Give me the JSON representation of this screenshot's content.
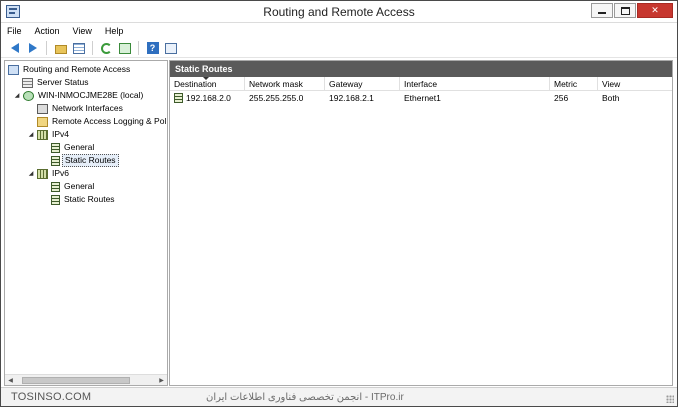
{
  "window": {
    "title": "Routing and Remote Access"
  },
  "menu": [
    "File",
    "Action",
    "View",
    "Help"
  ],
  "toolbar": {
    "icons": [
      "back-arrow-icon",
      "forward-arrow-icon",
      "up-folder-icon",
      "show-hide-tree-icon",
      "refresh-icon",
      "export-list-icon",
      "help-icon",
      "properties-icon"
    ]
  },
  "tree": {
    "items": [
      {
        "label": "Routing and Remote Access",
        "icon": "rra-icon",
        "level": 0,
        "expander": ""
      },
      {
        "label": "Server Status",
        "icon": "server-status-icon",
        "level": 1,
        "expander": ""
      },
      {
        "label": "WIN-INMOCJME28E (local)",
        "icon": "local-server-icon",
        "level": 1,
        "expander": "◢"
      },
      {
        "label": "Network Interfaces",
        "icon": "network-interfaces-icon",
        "level": 2,
        "expander": ""
      },
      {
        "label": "Remote Access Logging & Pol",
        "icon": "logging-icon",
        "level": 2,
        "expander": ""
      },
      {
        "label": "IPv4",
        "icon": "ipv4-icon",
        "level": 2,
        "expander": "◢"
      },
      {
        "label": "General",
        "icon": "general-icon",
        "level": 3,
        "expander": ""
      },
      {
        "label": "Static Routes",
        "icon": "static-routes-icon",
        "level": 3,
        "expander": "",
        "selected": true
      },
      {
        "label": "IPv6",
        "icon": "ipv6-icon",
        "level": 2,
        "expander": "◢"
      },
      {
        "label": "General",
        "icon": "general-icon",
        "level": 3,
        "expander": ""
      },
      {
        "label": "Static Routes",
        "icon": "static-routes-icon",
        "level": 3,
        "expander": ""
      }
    ]
  },
  "right_pane": {
    "header": "Static Routes",
    "columns": [
      "Destination",
      "Network mask",
      "Gateway",
      "Interface",
      "Metric",
      "View"
    ],
    "rows": [
      {
        "destination": "192.168.2.0",
        "mask": "255.255.255.0",
        "gateway": "192.168.2.1",
        "interface": "Ethernet1",
        "metric": "256",
        "view": "Both"
      }
    ]
  },
  "statusbar": {
    "watermark_left": "TOSINSO.COM",
    "watermark_center": "ITPro.ir - انجمن تخصصی فناوری اطلاعات ایران"
  }
}
